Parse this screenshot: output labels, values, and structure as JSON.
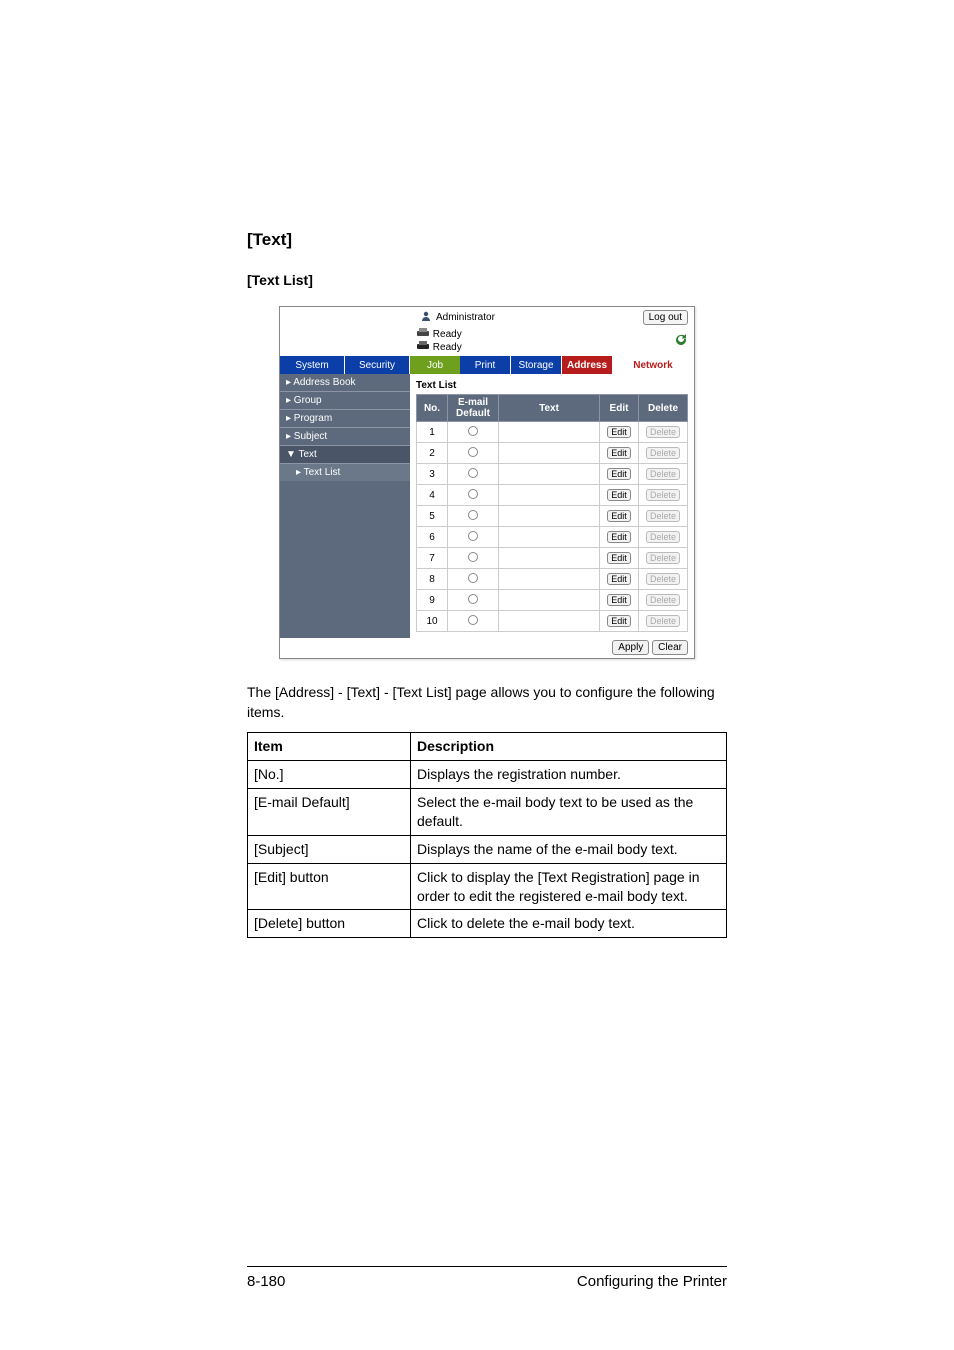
{
  "headings": {
    "section": "[Text]",
    "subsection": "[Text List]"
  },
  "screenshot": {
    "admin_label": "Administrator",
    "logout_label": "Log out",
    "ready_label": "Ready",
    "tabs_lead": [
      "System",
      "Security"
    ],
    "tabs_main": [
      "Job",
      "Print",
      "Storage",
      "Address",
      "Network"
    ],
    "sidebar": {
      "address_book": "▸ Address Book",
      "group": "▸ Group",
      "program": "▸ Program",
      "subject": "▸ Subject",
      "text": "▼ Text",
      "text_list": "▸ Text List"
    },
    "table": {
      "title": "Text List",
      "headers": {
        "no": "No.",
        "default": "E-mail Default",
        "text": "Text",
        "edit": "Edit",
        "delete": "Delete"
      },
      "rows": [
        {
          "no": "1",
          "text": ""
        },
        {
          "no": "2",
          "text": ""
        },
        {
          "no": "3",
          "text": ""
        },
        {
          "no": "4",
          "text": ""
        },
        {
          "no": "5",
          "text": ""
        },
        {
          "no": "6",
          "text": ""
        },
        {
          "no": "7",
          "text": ""
        },
        {
          "no": "8",
          "text": ""
        },
        {
          "no": "9",
          "text": ""
        },
        {
          "no": "10",
          "text": ""
        }
      ],
      "edit_label": "Edit",
      "delete_label": "Delete"
    },
    "apply_label": "Apply",
    "clear_label": "Clear"
  },
  "paragraph": "The [Address] - [Text] - [Text List] page allows you to configure the following items.",
  "desc_table": {
    "header_item": "Item",
    "header_desc": "Description",
    "rows": [
      {
        "item": "[No.]",
        "desc": "Displays the registration number."
      },
      {
        "item": "[E-mail Default]",
        "desc": "Select the e-mail body text to be used as the default."
      },
      {
        "item": "[Subject]",
        "desc": "Displays the name of the e-mail body text."
      },
      {
        "item": "[Edit] button",
        "desc": "Click to display the [Text Registration] page in order to edit the registered e-mail body text."
      },
      {
        "item": "[Delete] button",
        "desc": "Click to delete the e-mail body text."
      }
    ]
  },
  "footer": {
    "page_number": "8-180",
    "title": "Configuring the Printer"
  }
}
